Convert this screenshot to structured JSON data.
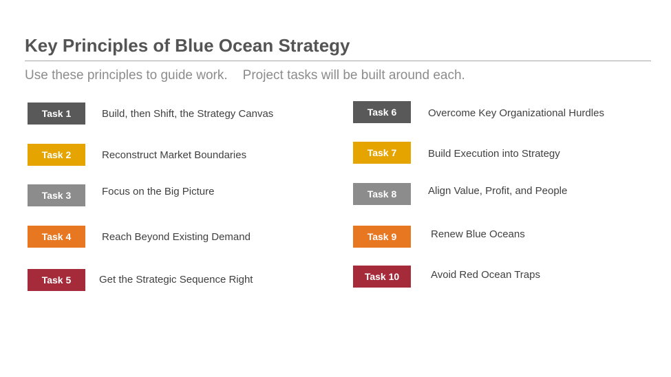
{
  "slide": {
    "title": "Key Principles of Blue Ocean Strategy",
    "subtitle_part1": "Use these principles to guide work.",
    "subtitle_part2": "Project tasks will be built around each."
  },
  "colors": {
    "dark_gray": "#595959",
    "gold": "#e5a400",
    "gray": "#8c8c8c",
    "orange": "#e87722",
    "maroon": "#a52a3a"
  },
  "tasks": [
    {
      "label": "Task 1",
      "description": "Build,  then Shift, the Strategy Canvas",
      "color": "#595959"
    },
    {
      "label": "Task 2",
      "description": "Reconstruct Market Boundaries",
      "color": "#e5a400"
    },
    {
      "label": "Task 3",
      "description": "Focus on the Big Picture",
      "color": "#8c8c8c"
    },
    {
      "label": "Task 4",
      "description": "Reach Beyond Existing Demand",
      "color": "#e87722"
    },
    {
      "label": "Task 5",
      "description": "Get the Strategic Sequence Right",
      "color": "#a52a3a"
    },
    {
      "label": "Task 6",
      "description": "Overcome Key Organizational  Hurdles",
      "color": "#595959"
    },
    {
      "label": "Task 7",
      "description": "Build Execution into Strategy",
      "color": "#e5a400"
    },
    {
      "label": "Task 8",
      "description": "Align Value,  Profit, and People",
      "color": "#8c8c8c"
    },
    {
      "label": "Task 9",
      "description": "Renew  Blue Oceans",
      "color": "#e87722"
    },
    {
      "label": "Task 10",
      "description": "Avoid Red Ocean Traps",
      "color": "#a52a3a"
    }
  ]
}
